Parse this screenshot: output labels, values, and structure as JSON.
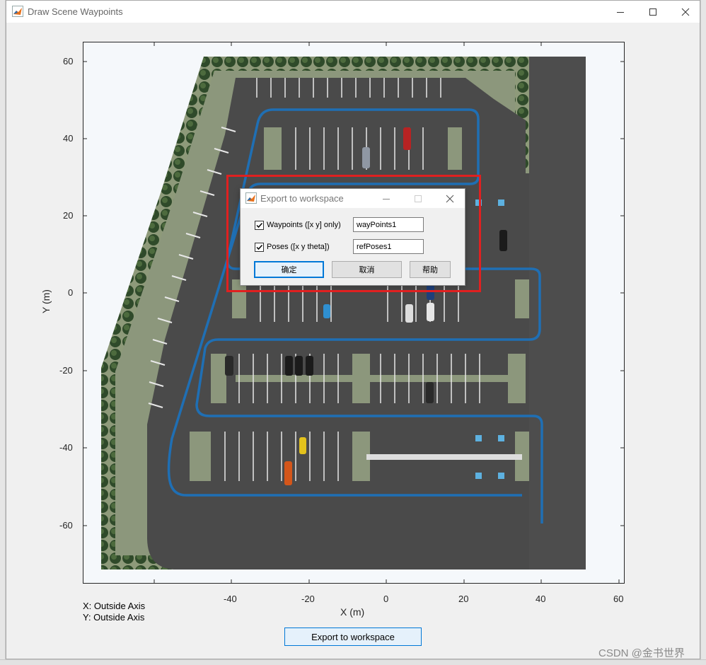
{
  "window": {
    "title": "Draw Scene Waypoints",
    "colors": {
      "titlebar": "#ffffff",
      "body": "#f0f0f0"
    },
    "controls": [
      "minimize-icon",
      "maximize-icon",
      "close-icon"
    ]
  },
  "plot": {
    "xlabel": "X (m)",
    "ylabel": "Y (m)",
    "xlim": [
      -78,
      62
    ],
    "ylim": [
      -75,
      65
    ],
    "xticks": [
      "-40",
      "-20",
      "0",
      "20",
      "40",
      "60"
    ],
    "yticks": [
      "60",
      "40",
      "20",
      "0",
      "-20",
      "-40",
      "-60"
    ],
    "background": "aerial parking lot scene",
    "path_color": "#1f6fb4",
    "waypoint_path": [
      [
        38,
        -60
      ],
      [
        38,
        -39
      ],
      [
        36,
        -36
      ],
      [
        -54,
        -36
      ],
      [
        -57,
        -40
      ],
      [
        -57,
        -50
      ],
      [
        -54,
        -52
      ],
      [
        35,
        -52
      ]
    ]
  },
  "status": {
    "x_readout": "X: Outside Axis",
    "y_readout": "Y: Outside Axis"
  },
  "export_button": {
    "label": "Export to workspace"
  },
  "dialog": {
    "title": "Export to workspace",
    "waypoints": {
      "label": "Waypoints ([x y] only)",
      "checked": true,
      "value": "wayPoints1"
    },
    "poses": {
      "label": "Poses ([x y theta])",
      "checked": true,
      "value": "refPoses1"
    },
    "buttons": {
      "ok": "确定",
      "cancel": "取消",
      "help": "帮助"
    }
  },
  "watermark": "CSDN @金书世界",
  "highlight_color": "#e02020"
}
